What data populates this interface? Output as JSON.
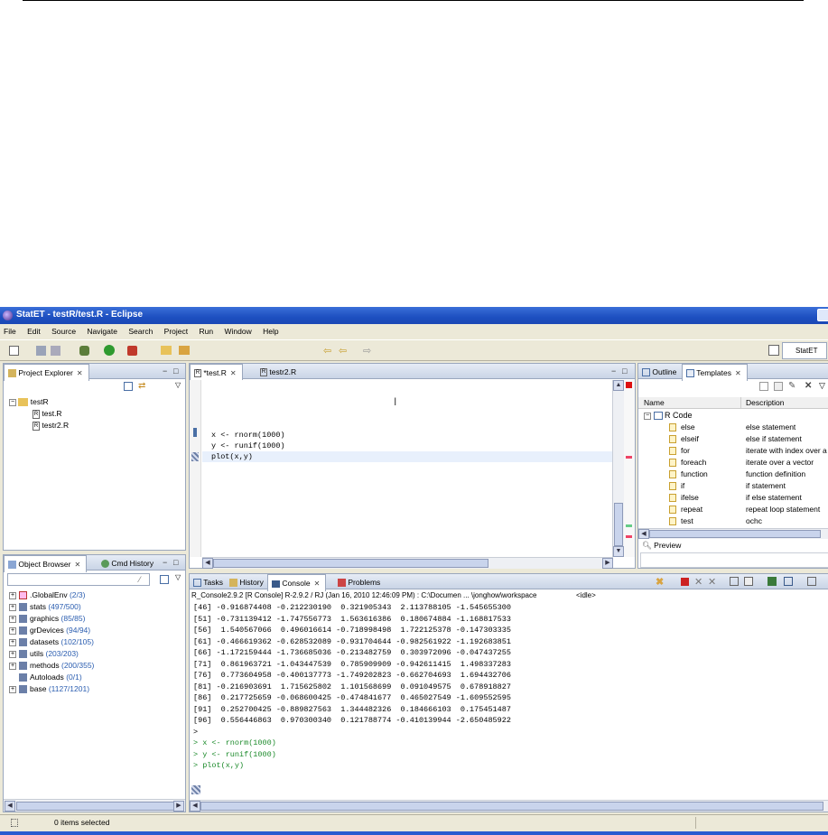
{
  "window": {
    "title": "StatET - testR/test.R - Eclipse"
  },
  "menu": [
    "File",
    "Edit",
    "Source",
    "Navigate",
    "Search",
    "Project",
    "Run",
    "Window",
    "Help"
  ],
  "perspective": {
    "label": "StatET"
  },
  "project_explorer": {
    "tab": "Project Explorer",
    "tree": [
      {
        "label": "testR",
        "kind": "project",
        "level": 0
      },
      {
        "label": "test.R",
        "kind": "file",
        "level": 1
      },
      {
        "label": "testr2.R",
        "kind": "file",
        "level": 1
      }
    ]
  },
  "object_browser": {
    "tabs": [
      "Object Browser",
      "Cmd History"
    ],
    "items": [
      {
        "name": ".GlobalEnv",
        "count": "(2/3)"
      },
      {
        "name": "stats",
        "count": "(497/500)"
      },
      {
        "name": "graphics",
        "count": "(85/85)"
      },
      {
        "name": "grDevices",
        "count": "(94/94)"
      },
      {
        "name": "datasets",
        "count": "(102/105)"
      },
      {
        "name": "utils",
        "count": "(203/203)"
      },
      {
        "name": "methods",
        "count": "(200/355)"
      },
      {
        "name": "Autoloads",
        "count": "(0/1)"
      },
      {
        "name": "base",
        "count": "(1127/1201)"
      }
    ]
  },
  "editor": {
    "tabs": [
      "*test.R",
      "testr2.R"
    ],
    "lines": [
      "x <- rnorm(1000)",
      "y <- runif(1000)",
      "plot(x,y)"
    ]
  },
  "templates": {
    "tabs": [
      "Outline",
      "Templates"
    ],
    "columns": [
      "Name",
      "Description"
    ],
    "group": "R Code",
    "rows": [
      {
        "name": "else",
        "desc": "else statement"
      },
      {
        "name": "elseif",
        "desc": "else if statement"
      },
      {
        "name": "for",
        "desc": "iterate with index over a v"
      },
      {
        "name": "foreach",
        "desc": "iterate over a vector"
      },
      {
        "name": "function",
        "desc": "function definition"
      },
      {
        "name": "if",
        "desc": "if statement"
      },
      {
        "name": "ifelse",
        "desc": "if else statement"
      },
      {
        "name": "repeat",
        "desc": "repeat loop statement"
      },
      {
        "name": "test",
        "desc": "ochc"
      }
    ],
    "preview": "Preview"
  },
  "console": {
    "tabs": [
      "Tasks",
      "History",
      "Console",
      "Problems"
    ],
    "info": "R_Console2.9.2 [R Console] R-2.9.2 / RJ (Jan 16, 2010 12:46:09 PM) : C:\\Documen ... \\jonghow\\workspace",
    "status": "<idle>",
    "output": [
      "[46] -0.916874408 -0.212230190  0.321905343  2.113788105 -1.545655300",
      "[51] -0.731139412 -1.747556773  1.563616386  0.180674884 -1.168817533",
      "[56]  1.540567066  0.496016614 -0.718998498  1.722125378 -0.147303335",
      "[61] -0.466619362 -0.628532089 -0.931704644 -0.982561922 -1.192683851",
      "[66] -1.172159444 -1.736685036 -0.213482759  0.303972096 -0.047437255",
      "[71]  0.861963721 -1.043447539  0.785909909 -0.942611415  1.498337283",
      "[76]  0.773604958 -0.400137773 -1.749202823 -0.662704693  1.694432706",
      "[81] -0.216903691  1.715625802  1.101568699  0.091049575  0.678918827",
      "[86]  0.217725659 -0.068600425 -0.474841677  0.465027549 -1.609552595",
      "[91]  0.252700425 -0.889827563  1.344482326  0.184666103  0.175451487",
      "[96]  0.556446863  0.970300340  0.121788774 -0.410139944 -2.650485922"
    ],
    "commands": [
      ">",
      "> x <- rnorm(1000)",
      "> y <- runif(1000)",
      "> plot(x,y)"
    ]
  },
  "statusbar": {
    "text": "0 items selected"
  }
}
